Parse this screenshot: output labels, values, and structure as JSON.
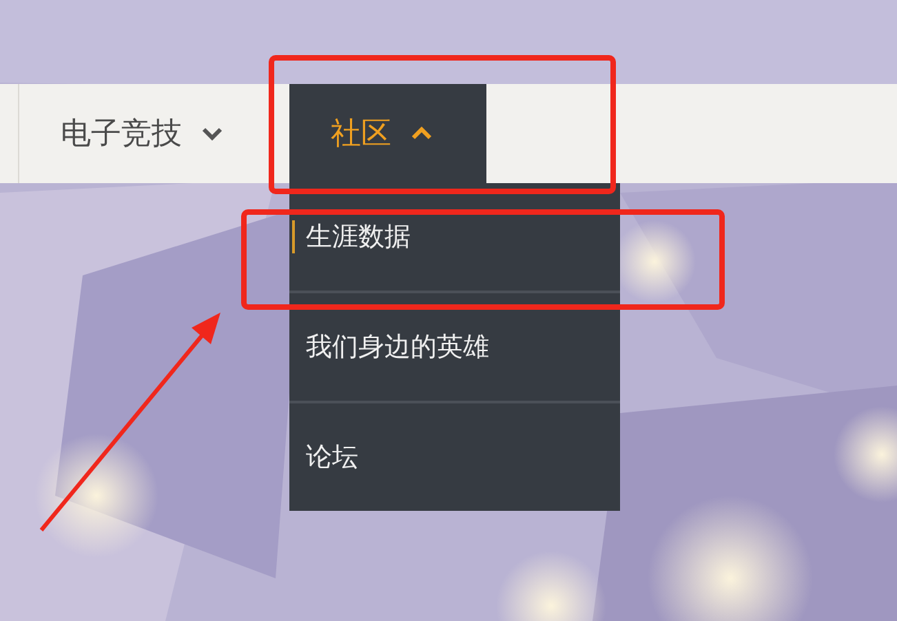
{
  "nav": [
    {
      "label": "电子竞技",
      "expanded": false,
      "selected": false
    },
    {
      "label": "社区",
      "expanded": true,
      "selected": true,
      "items": [
        {
          "label": "生涯数据",
          "selected": true
        },
        {
          "label": "我们身边的英雄",
          "selected": false
        },
        {
          "label": "论坛",
          "selected": false
        }
      ]
    }
  ],
  "annotations": [
    {
      "kind": "box"
    },
    {
      "kind": "box"
    },
    {
      "kind": "arrow"
    }
  ]
}
